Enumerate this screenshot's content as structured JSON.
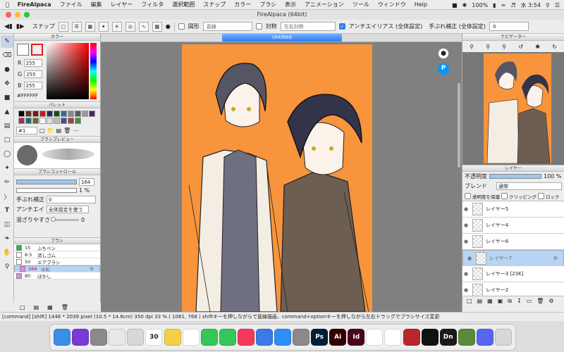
{
  "menubar": {
    "app": "FireAlpaca",
    "items": [
      "ファイル",
      "編集",
      "レイヤー",
      "フィルタ",
      "選択範囲",
      "スナップ",
      "カラー",
      "ブラシ",
      "表示",
      "アニメーション",
      "ツール",
      "ウィンドウ",
      "Help"
    ],
    "battery": "100%",
    "clock": "水 3:54"
  },
  "window_title": "FireAlpaca (64bit)",
  "toolbar": {
    "snap_label": "スナップ",
    "shape_label": "図形",
    "shape_value": "直線",
    "symmetry_label": "対称",
    "symmetry_value": "左右対称",
    "antialias_label": "アンチエイリアス (全体設定)",
    "stabilizer_label": "手ぶれ補正 (全体設定)",
    "stabilizer_value": "0"
  },
  "color_panel": {
    "title": "カラー",
    "r_label": "R",
    "r_value": "255",
    "g_label": "G",
    "g_value": "255",
    "b_label": "B",
    "b_value": "255",
    "hex": "#FFFFFF",
    "primary_color": "#ffffff"
  },
  "palette_panel": {
    "title": "パレット",
    "selected": "#1",
    "colors": [
      "#000000",
      "#5a3a22",
      "#7a1a1a",
      "#c41a1a",
      "#2a2a5a",
      "#1a4a1a",
      "#3a6a9a",
      "#8a8a8a",
      "#5a5a5a",
      "#9a9a9a",
      "#4a2a5a",
      "#aa2a6a",
      "#2a6a6a",
      "#6a6a2a",
      "#ffffff",
      "#dddddd",
      "#bbbbbb",
      "#4a4a8a",
      "#8a4a4a",
      "#4a8a4a"
    ]
  },
  "brush_preview_panel": {
    "title": "ブラシプレビュー"
  },
  "brush_control": {
    "title": "ブラシコントロール",
    "size": "164",
    "opacity": "1 %",
    "stabilizer_label": "手ぶれ補正",
    "stabilizer_value": "0",
    "antialias_label": "アンチエイ",
    "antialias_value": "全体設定を使う",
    "blend_label": "混ざりやすさ",
    "blend_value": "0"
  },
  "brush_panel": {
    "title": "ブラシ",
    "items": [
      {
        "size": "15",
        "name": "ふちペン",
        "color": "#2db82d"
      },
      {
        "size": "8.5",
        "name": "消しゴム",
        "color": "#ffffff"
      },
      {
        "size": "50",
        "name": "エアブラシ",
        "color": "#ffffff"
      },
      {
        "size": "164",
        "name": "水彩",
        "color": "#ee82ee",
        "selected": true
      },
      {
        "size": "80",
        "name": "ぼかし",
        "color": "#ee82ee"
      }
    ]
  },
  "document": {
    "tab_title": "Untitled",
    "background_color": "#f7943c"
  },
  "navigator": {
    "title": "ナビゲーター"
  },
  "layer_panel": {
    "title": "レイヤー",
    "opacity_label": "不透明度",
    "opacity_value": "100 %",
    "opacity_fraction": 1.0,
    "blend_label": "ブレンド",
    "blend_value": "通常",
    "protect_label": "透明度を保護",
    "clipping_label": "クリッピング",
    "lock_label": "ロック",
    "layers": [
      {
        "name": "レイヤー5",
        "selected": false
      },
      {
        "name": "レイヤー4",
        "selected": false
      },
      {
        "name": "レイヤー6",
        "selected": false
      },
      {
        "name": "レイヤー7",
        "selected": true
      },
      {
        "name": "レイヤー3 [23K]",
        "selected": false
      },
      {
        "name": "レイヤー2",
        "selected": false
      }
    ]
  },
  "status": {
    "text": "[command] [shift]   1446 * 2039 pixel  (10.5 * 14.8cm)  350 dpi   33 %  ( 1061, 768 )   shiftキーを押しながらで直線描画、command+optionキーを押しながら左右ドラッグでブラシサイズ変更"
  },
  "dock": {
    "calendar_day": "30",
    "apps": [
      {
        "name": "finder",
        "label": "",
        "color": "#3a8ee6"
      },
      {
        "name": "siri",
        "label": "",
        "color": "#7a3ad6"
      },
      {
        "name": "launchpad",
        "label": "",
        "color": "#8a8a8a"
      },
      {
        "name": "chrome",
        "label": "",
        "color": "#e8e8e8"
      },
      {
        "name": "photos",
        "label": "",
        "color": "#d8d8d8"
      },
      {
        "name": "calendar",
        "label": "30",
        "color": "#ffffff"
      },
      {
        "name": "notes",
        "label": "",
        "color": "#f3d04a"
      },
      {
        "name": "reminders",
        "label": "",
        "color": "#ffffff"
      },
      {
        "name": "messages",
        "label": "",
        "color": "#35c759"
      },
      {
        "name": "facetime",
        "label": "",
        "color": "#35c759"
      },
      {
        "name": "music",
        "label": "",
        "color": "#f43a5a"
      },
      {
        "name": "keynote",
        "label": "",
        "color": "#3a7ae6"
      },
      {
        "name": "app-store",
        "label": "",
        "color": "#2f8ef5"
      },
      {
        "name": "settings",
        "label": "",
        "color": "#8a8a8a"
      },
      {
        "name": "photoshop",
        "label": "Ps",
        "color": "#001e36"
      },
      {
        "name": "illustrator",
        "label": "Ai",
        "color": "#330000"
      },
      {
        "name": "indesign",
        "label": "Id",
        "color": "#49021f"
      },
      {
        "name": "firealpaca",
        "label": "",
        "color": "#ffffff"
      },
      {
        "name": "clip",
        "label": "",
        "color": "#ffffff"
      },
      {
        "name": "game",
        "label": "",
        "color": "#b8272e"
      },
      {
        "name": "inkscape",
        "label": "",
        "color": "#111111"
      },
      {
        "name": "dimension",
        "label": "Dn",
        "color": "#1a1a1a"
      },
      {
        "name": "minecraft",
        "label": "",
        "color": "#5a8a3a"
      },
      {
        "name": "discord",
        "label": "",
        "color": "#5865f2"
      },
      {
        "name": "trash",
        "label": "",
        "color": "#d8d8d8"
      }
    ]
  }
}
